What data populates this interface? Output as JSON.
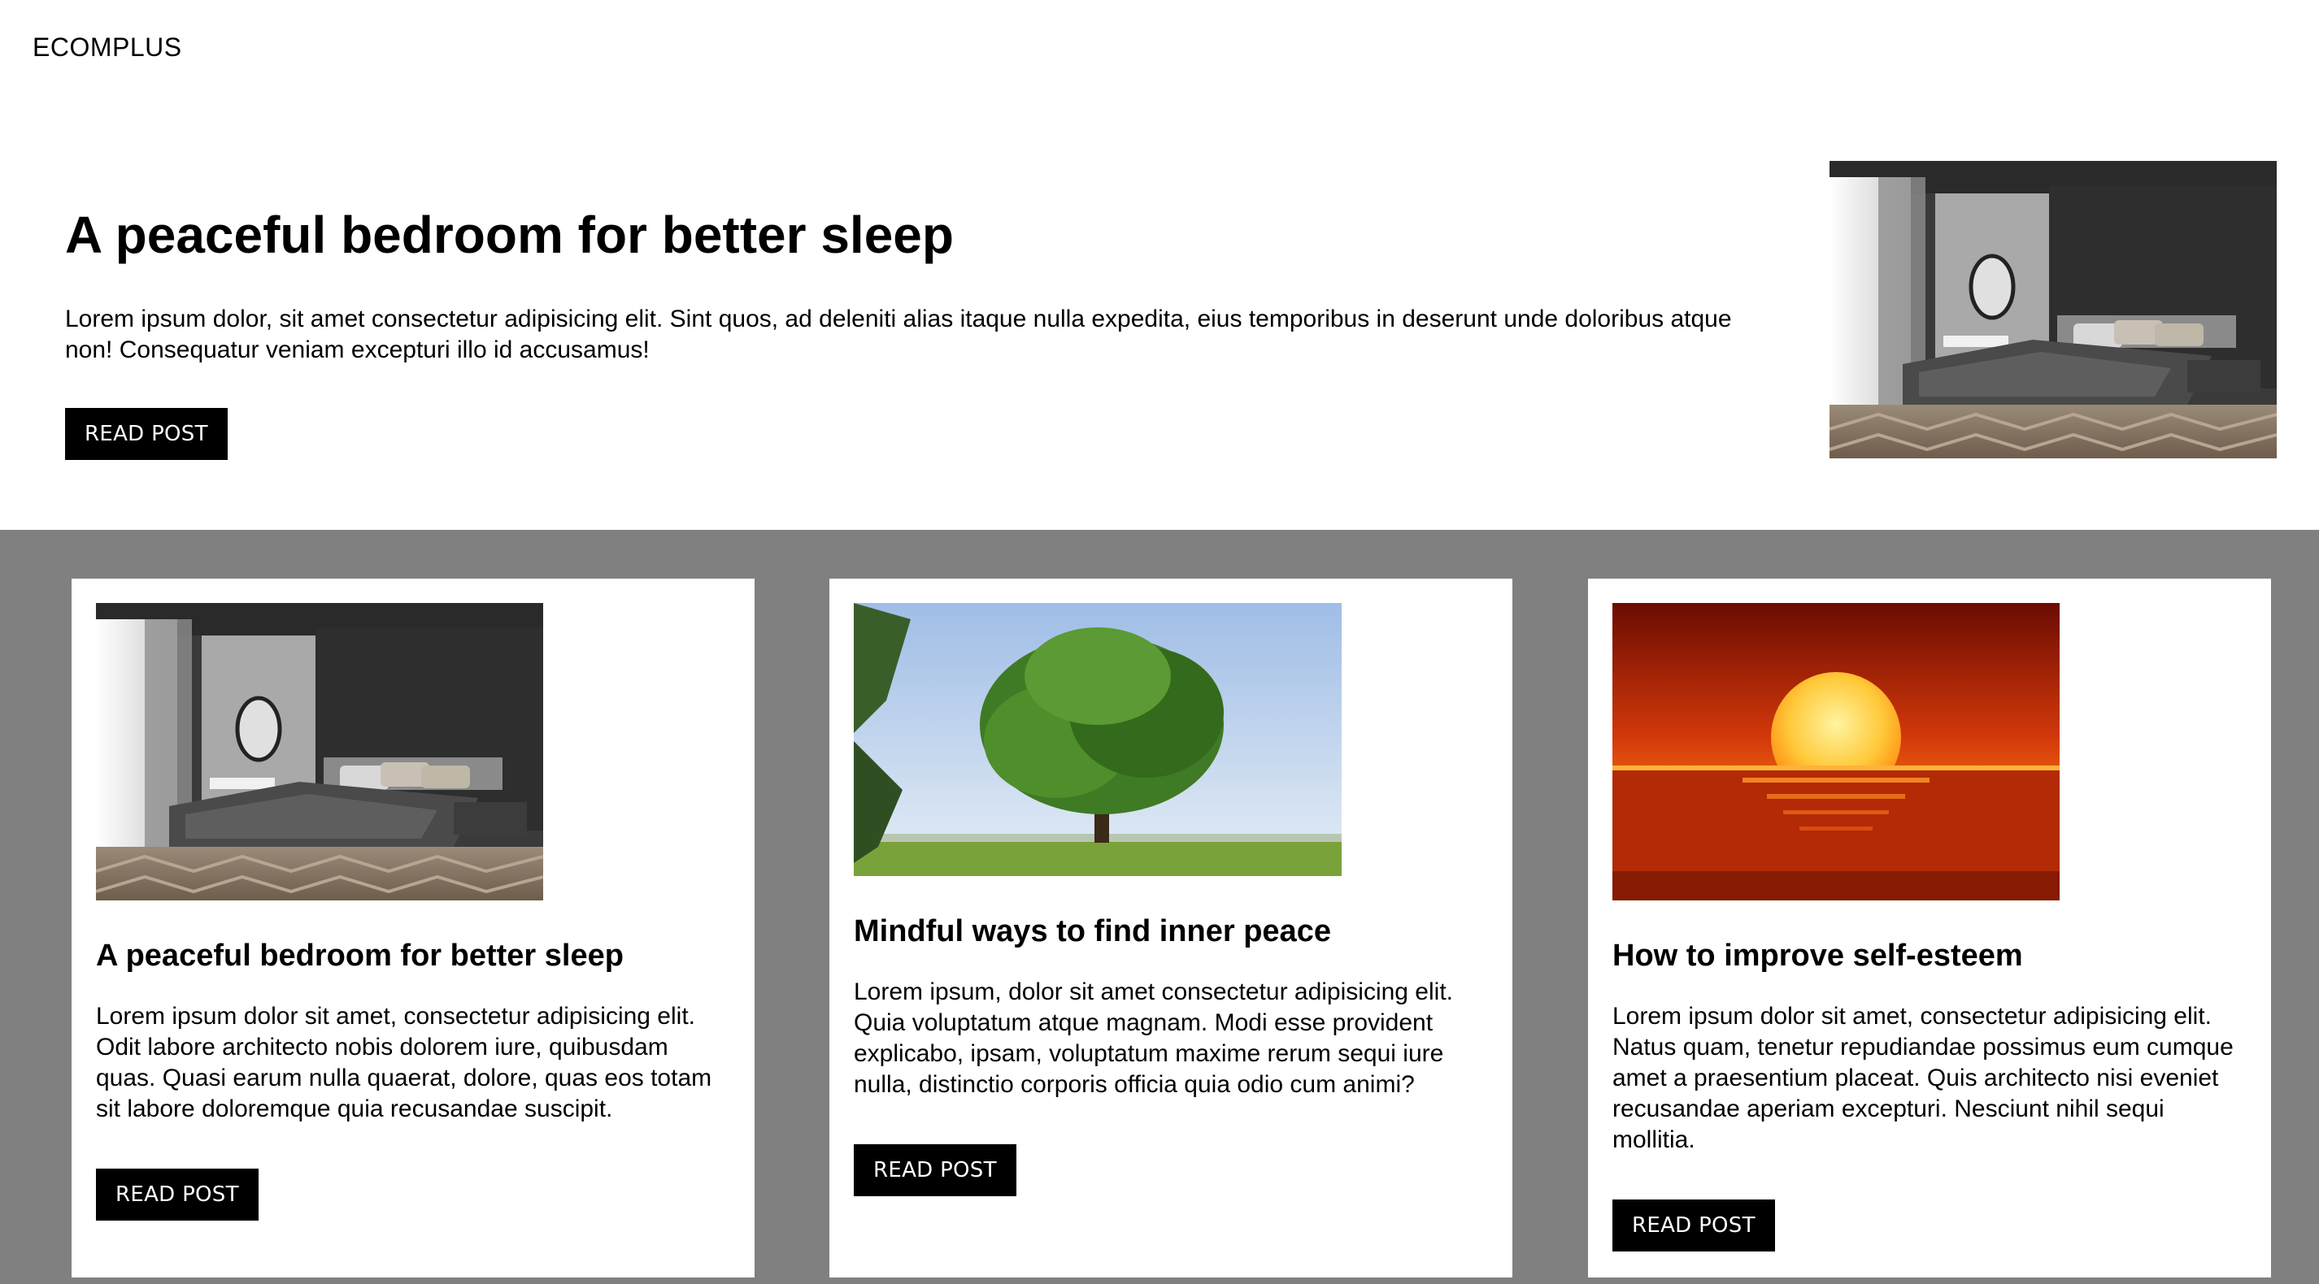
{
  "brand": {
    "logo": "ECOMPLUS"
  },
  "hero": {
    "title": "A peaceful bedroom for better sleep",
    "body": "Lorem ipsum dolor, sit amet consectetur adipisicing elit. Sint quos, ad deleniti alias itaque nulla expedita, eius temporibus in deserunt unde doloribus atque non! Consequatur veniam excepturi illo id accusamus!",
    "button": "READ POST",
    "image": "bedroom-photo"
  },
  "cards": [
    {
      "image": "bedroom-photo",
      "title": "A peaceful bedroom for better sleep",
      "body": "Lorem ipsum dolor sit amet, consectetur adipisicing elit. Odit labore architecto nobis dolorem iure, quibusdam quas. Quasi earum nulla quaerat, dolore, quas eos totam sit labore doloremque quia recusandae suscipit.",
      "button": "READ POST"
    },
    {
      "image": "tree-photo",
      "title": "Mindful ways to find inner peace",
      "body": "Lorem ipsum, dolor sit amet consectetur adipisicing elit. Quia voluptatum atque magnam. Modi esse provident explicabo, ipsam, voluptatum maxime rerum sequi iure nulla, distinctio corporis officia quia odio cum animi?",
      "button": "READ POST"
    },
    {
      "image": "sunset-photo",
      "title": "How to improve self-esteem",
      "body": "Lorem ipsum dolor sit amet, consectetur adipisicing elit. Natus quam, tenetur repudiandae possimus eum cumque amet a praesentium placeat. Quis architecto nisi eveniet recusandae aperiam excepturi. Nesciunt nihil sequi mollitia.",
      "button": "READ POST"
    }
  ],
  "colors": {
    "band": "#808080",
    "button_bg": "#000000",
    "button_text": "#ffffff"
  }
}
